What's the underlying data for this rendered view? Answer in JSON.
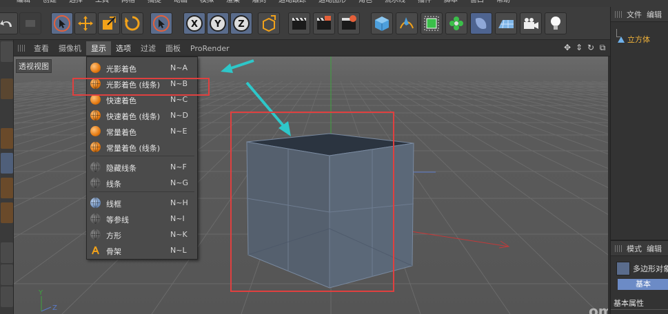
{
  "menubar": {
    "items": [
      "编辑",
      "创建",
      "选择",
      "工具",
      "网格",
      "捕捉",
      "动画",
      "模拟",
      "渲染",
      "雕刻",
      "运动跟踪",
      "运动图形",
      "角色",
      "流水线",
      "插件",
      "脚本",
      "窗口",
      "帮助"
    ]
  },
  "viewport": {
    "menu": [
      "查看",
      "摄像机",
      "显示",
      "选项",
      "过滤",
      "面板",
      "ProRender"
    ],
    "active_menu": "显示",
    "label": "透视视图",
    "axis_y": "Y",
    "axis_z": "Z",
    "watermark": "om"
  },
  "display_menu": {
    "items": [
      {
        "label": "光影着色",
        "shortcut": "N~A",
        "icon": "shaded-sphere-icon"
      },
      {
        "label": "光影着色 (线条)",
        "shortcut": "N~B",
        "icon": "shaded-lines-sphere-icon",
        "highlighted": true
      },
      {
        "label": "快速着色",
        "shortcut": "N~C",
        "icon": "quick-shading-icon"
      },
      {
        "label": "快速着色 (线条)",
        "shortcut": "N~D",
        "icon": "quick-shading-lines-icon"
      },
      {
        "label": "常量着色",
        "shortcut": "N~E",
        "icon": "constant-shading-icon"
      },
      {
        "label": "常量着色 (线条)",
        "shortcut": "",
        "icon": "constant-shading-lines-icon"
      },
      {
        "label": "隐藏线条",
        "shortcut": "N~F",
        "icon": "hidden-line-icon"
      },
      {
        "label": "线条",
        "shortcut": "N~G",
        "icon": "lines-icon"
      },
      {
        "label": "线框",
        "shortcut": "N~H",
        "icon": "wireframe-icon"
      },
      {
        "label": "等参线",
        "shortcut": "N~I",
        "icon": "isoparms-icon"
      },
      {
        "label": "方形",
        "shortcut": "N~K",
        "icon": "box-icon"
      },
      {
        "label": "骨架",
        "shortcut": "N~L",
        "icon": "skeleton-icon"
      }
    ]
  },
  "right_panel": {
    "tabs": [
      "文件",
      "编辑"
    ],
    "object_name": "立方体",
    "attr_tabs": [
      "模式",
      "编辑"
    ],
    "attr_object": "多边形对象",
    "attr_basic": "基本",
    "attr_section": "基本属性"
  },
  "colors": {
    "accent_orange": "#e47a12",
    "highlight_red": "#e0403f",
    "arrow_cyan": "#2ec7c9",
    "selection_blue": "#6c8bc6"
  }
}
